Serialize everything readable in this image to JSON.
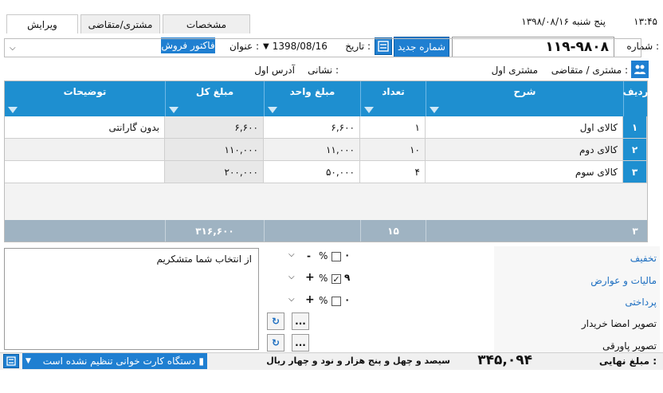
{
  "tabs": [
    {
      "label": "ویرایش"
    },
    {
      "label": "مشتری/متقاضی"
    },
    {
      "label": "مشخصات"
    }
  ],
  "clock": {
    "time": "۱۳:۴۵",
    "date": "پنج شنبه ۱۳۹۸/۰۸/۱۶"
  },
  "header": {
    "number_label": "شماره :",
    "number_value": "۱۱۹-۹۸۰۸",
    "new_number_button": "شماره جدید",
    "date_label": "تاریخ :",
    "date_value": "1398/08/16",
    "title_label": "عنوان :",
    "title_value": "فاکتور فروش",
    "customer_label": "مشتری / متقاضی :",
    "customer_value": "مشتری اول",
    "address_label": "نشانی :",
    "address_value": "آدرس اول"
  },
  "table": {
    "columns": [
      "ردیف",
      "شرح",
      "تعداد",
      "مبلغ واحد",
      "مبلغ کل",
      "توضیحات"
    ],
    "rows": [
      {
        "index": "۱",
        "desc": "کالای اول",
        "qty": "۱",
        "unit": "۶,۶۰۰",
        "total": "۶,۶۰۰",
        "note": "بدون گارانتی"
      },
      {
        "index": "۲",
        "desc": "کالای دوم",
        "qty": "۱۰",
        "unit": "۱۱,۰۰۰",
        "total": "۱۱۰,۰۰۰",
        "note": ""
      },
      {
        "index": "۳",
        "desc": "کالای سوم",
        "qty": "۴",
        "unit": "۵۰,۰۰۰",
        "total": "۲۰۰,۰۰۰",
        "note": ""
      }
    ],
    "summary": {
      "count": "۳",
      "qty": "۱۵",
      "total": "۳۱۶,۶۰۰"
    }
  },
  "notes": {
    "text": "از انتخاب شما متشکریم"
  },
  "adjustments": [
    {
      "label": "تخفیف",
      "value": "۰",
      "checked": false,
      "sign": "-"
    },
    {
      "label": "مالیات و عوارض",
      "value": "۹",
      "checked": true,
      "sign": "+"
    },
    {
      "label": "پرداختی",
      "value": "۰",
      "checked": false,
      "sign": "+"
    }
  ],
  "images": [
    {
      "label": "تصویر امضا خریدار",
      "button": "..."
    },
    {
      "label": "تصویر پاورقی",
      "button": "..."
    }
  ],
  "footer": {
    "final_label": "مبلغ نهایی :",
    "final_value": "۳۴۵,۰۹۴",
    "final_words": "سیصد و چهل و پنج هزار و نود و چهار ریال",
    "card_reader": "دستگاه کارت خوانی تنظیم نشده است"
  },
  "percent_sign": "%",
  "colors": {
    "accent": "#1e8fd0",
    "link": "#1e6fc1",
    "sum_bar": "#9fb3c2"
  }
}
